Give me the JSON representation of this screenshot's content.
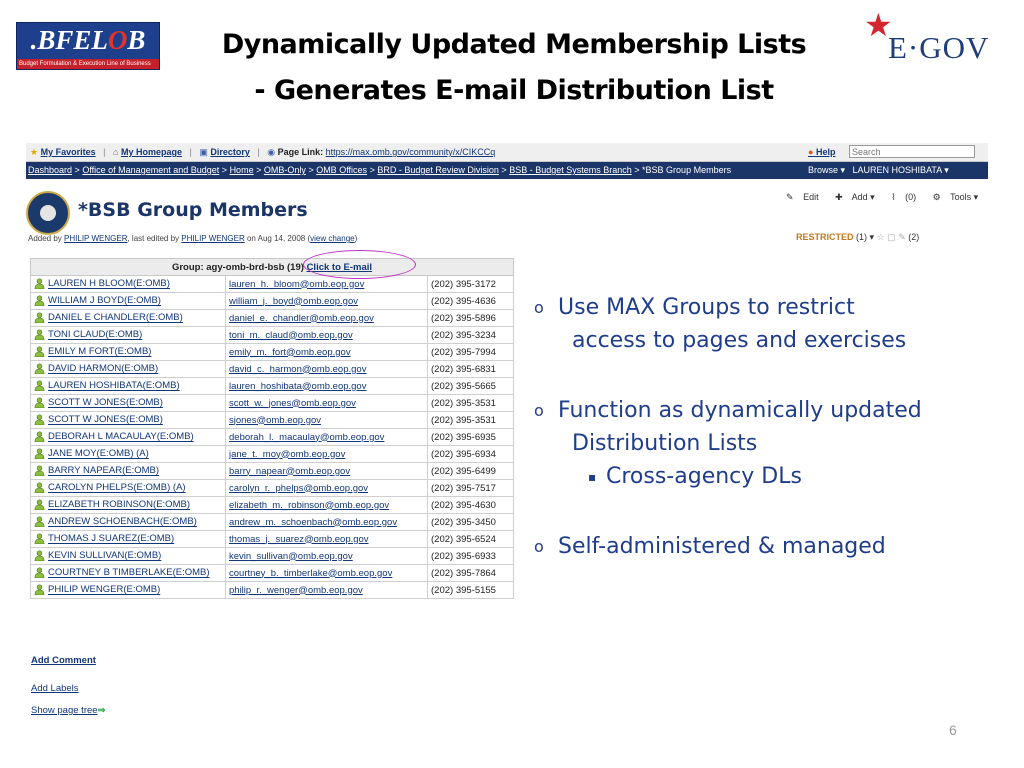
{
  "slide": {
    "title_line1": "Dynamically Updated Membership Lists",
    "title_line2": "- Generates E-mail Distribution List",
    "logo_left": {
      "text_main": ".BFEL",
      "text_accent": "O",
      "text_tail": "B",
      "subtitle": "Budget Formulation & Execution Line of Business"
    },
    "logo_right": {
      "text": "E·GOV",
      "star": "★"
    },
    "page_number": "6",
    "colors": {
      "accent": "#1c3568",
      "bullet": "#1f3d8a",
      "ring": "#c033c6"
    }
  },
  "toolbar": {
    "my_favorites": "My Favorites",
    "my_homepage": "My Homepage",
    "directory": "Directory",
    "page_link_label": "Page Link:",
    "page_link_url": "https://max.omb.gov/community/x/CIKCCq",
    "help": "Help",
    "search_placeholder": "Search",
    "separator": "|"
  },
  "breadcrumb": {
    "items": [
      "Dashboard",
      "Office of Management and Budget",
      "Home",
      "OMB-Only",
      "OMB Offices",
      "BRD - Budget Review Division",
      "BSB - Budget Systems Branch"
    ],
    "current": "*BSB Group Members",
    "sep": ">",
    "browse": "Browse ▾",
    "user": "LAUREN HOSHIBATA ▾"
  },
  "page": {
    "title": "*BSB Group Members",
    "added_by_prefix": "Added by",
    "added_by": "PHILIP WENGER",
    "edited_prefix": ", last edited by",
    "edited_by": "PHILIP WENGER",
    "date_text": "on Aug 14, 2008",
    "view_change": "view change",
    "actions": {
      "edit": "Edit",
      "add": "Add ▾",
      "attach": "(0)",
      "tools": "Tools ▾"
    },
    "restricted": {
      "label": "RESTRICTED",
      "count": "(1) ▾",
      "comments": "(2)"
    }
  },
  "group": {
    "header_text": "Group: agy-omb-brd-bsb (19)",
    "email_link": "Click to E-mail",
    "members": [
      {
        "name": "LAUREN H BLOOM(E:OMB)",
        "email": "lauren_h._bloom@omb.eop.gov",
        "phone": "(202) 395-3172"
      },
      {
        "name": "WILLIAM J BOYD(E:OMB)",
        "email": "william_j._boyd@omb.eop.gov",
        "phone": "(202) 395-4636"
      },
      {
        "name": "DANIEL E CHANDLER(E:OMB)",
        "email": "daniel_e._chandler@omb.eop.gov",
        "phone": "(202) 395-5896"
      },
      {
        "name": "TONI CLAUD(E:OMB)",
        "email": "toni_m._claud@omb.eop.gov",
        "phone": "(202) 395-3234"
      },
      {
        "name": "EMILY M FORT(E:OMB)",
        "email": "emily_m._fort@omb.eop.gov",
        "phone": "(202) 395-7994"
      },
      {
        "name": "DAVID HARMON(E:OMB)",
        "email": "david_c._harmon@omb.eop.gov",
        "phone": "(202) 395-6831"
      },
      {
        "name": "LAUREN HOSHIBATA(E:OMB)",
        "email": "lauren_hoshibata@omb.eop.gov",
        "phone": "(202) 395-5665"
      },
      {
        "name": "SCOTT W JONES(E:OMB)",
        "email": "scott_w._jones@omb.eop.gov",
        "phone": "(202) 395-3531"
      },
      {
        "name": "SCOTT W JONES(E:OMB)",
        "email": "sjones@omb.eop.gov",
        "phone": "(202) 395-3531"
      },
      {
        "name": "DEBORAH L MACAULAY(E:OMB)",
        "email": "deborah_l._macaulay@omb.eop.gov",
        "phone": "(202) 395-6935"
      },
      {
        "name": "JANE MOY(E:OMB) (A)",
        "email": "jane_t._moy@omb.eop.gov",
        "phone": "(202) 395-6934"
      },
      {
        "name": "BARRY NAPEAR(E:OMB)",
        "email": "barry_napear@omb.eop.gov",
        "phone": "(202) 395-6499"
      },
      {
        "name": "CAROLYN PHELPS(E:OMB) (A)",
        "email": "carolyn_r._phelps@omb.eop.gov",
        "phone": "(202) 395-7517"
      },
      {
        "name": "ELIZABETH ROBINSON(E:OMB)",
        "email": "elizabeth_m._robinson@omb.eop.gov",
        "phone": "(202) 395-4630"
      },
      {
        "name": "ANDREW SCHOENBACH(E:OMB)",
        "email": "andrew_m._schoenbach@omb.eop.gov",
        "phone": "(202) 395-3450"
      },
      {
        "name": "THOMAS J SUAREZ(E:OMB)",
        "email": "thomas_j._suarez@omb.eop.gov",
        "phone": "(202) 395-6524"
      },
      {
        "name": "KEVIN SULLIVAN(E:OMB)",
        "email": "kevin_sullivan@omb.eop.gov",
        "phone": "(202) 395-6933"
      },
      {
        "name": "COURTNEY B TIMBERLAKE(E:OMB)",
        "email": "courtney_b._timberlake@omb.eop.gov",
        "phone": "(202) 395-7864"
      },
      {
        "name": "PHILIP WENGER(E:OMB)",
        "email": "philip_r._wenger@omb.eop.gov",
        "phone": "(202) 395-5155"
      }
    ]
  },
  "footer_links": {
    "add_comment": "Add Comment",
    "add_labels": "Add Labels",
    "show_page_tree": "Show page tree",
    "arrow": "⇒"
  },
  "bullets": [
    {
      "marker": "o",
      "line1": "Use MAX Groups to restrict",
      "line2": "access to pages and exercises"
    },
    {
      "marker": "o",
      "line1": "Function as dynamically updated",
      "line2": "Distribution Lists",
      "sub": {
        "marker": "▪",
        "text": "Cross-agency DLs"
      }
    },
    {
      "marker": "o",
      "line1": "Self-administered & managed"
    }
  ],
  "icons": {
    "person": "user-icon",
    "home": "home-icon",
    "star": "star-icon",
    "book": "book-icon",
    "help": "help-icon",
    "edit": "pencil-icon",
    "add": "plus-icon",
    "attach": "paperclip-icon",
    "tools": "gear-icon",
    "comment": "comment-icon"
  }
}
